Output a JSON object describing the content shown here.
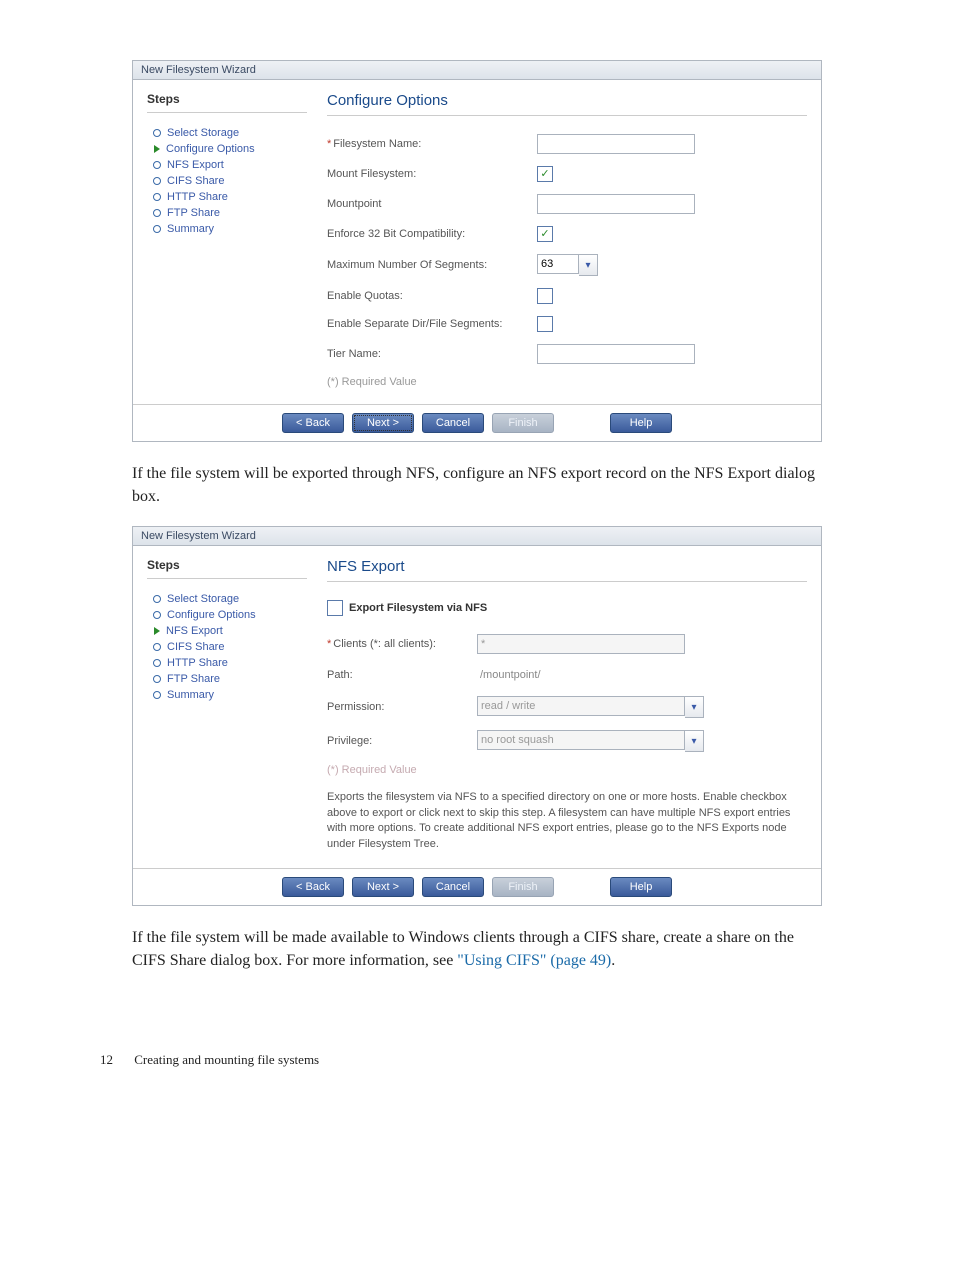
{
  "wizard1": {
    "window_title": "New Filesystem Wizard",
    "steps_heading": "Steps",
    "steps": [
      "Select Storage",
      "Configure Options",
      "NFS Export",
      "CIFS Share",
      "HTTP Share",
      "FTP Share",
      "Summary"
    ],
    "current_step_index": 1,
    "panel_title": "Configure Options",
    "fields": {
      "fs_name": {
        "label": "Filesystem Name:",
        "required": true,
        "value": ""
      },
      "mount_fs": {
        "label": "Mount Filesystem:",
        "checked": true
      },
      "mountpoint": {
        "label": "Mountpoint",
        "value": ""
      },
      "enforce32": {
        "label": "Enforce 32 Bit Compatibility:",
        "checked": true
      },
      "max_segments": {
        "label": "Maximum Number Of Segments:",
        "value": "63"
      },
      "quotas": {
        "label": "Enable Quotas:",
        "checked": false
      },
      "sep_segments": {
        "label": "Enable Separate Dir/File Segments:",
        "checked": false
      },
      "tier_name": {
        "label": "Tier Name:",
        "value": ""
      }
    },
    "required_note": "(*) Required Value",
    "buttons": {
      "back": "< Back",
      "next": "Next >",
      "cancel": "Cancel",
      "finish": "Finish",
      "help": "Help"
    }
  },
  "para1": "If the file system will be exported through NFS, configure an NFS export record on the NFS Export dialog box.",
  "wizard2": {
    "window_title": "New Filesystem Wizard",
    "steps_heading": "Steps",
    "steps": [
      "Select Storage",
      "Configure Options",
      "NFS Export",
      "CIFS Share",
      "HTTP Share",
      "FTP Share",
      "Summary"
    ],
    "current_step_index": 2,
    "panel_title": "NFS Export",
    "export_checkbox_label": "Export Filesystem via NFS",
    "export_checked": false,
    "fields": {
      "clients": {
        "label": "Clients (*: all clients):",
        "required": true,
        "value": "*"
      },
      "path": {
        "label": "Path:",
        "value": "/mountpoint/"
      },
      "permission": {
        "label": "Permission:",
        "value": "read / write"
      },
      "privilege": {
        "label": "Privilege:",
        "value": "no root squash"
      }
    },
    "required_note": "(*) Required Value",
    "help_text": "Exports the filesystem via NFS to a specified directory on one or more hosts. Enable checkbox above to export or click next to skip this step. A filesystem can have multiple NFS export entries with more options. To create additional NFS export entries, please go to the NFS Exports node under Filesystem Tree.",
    "buttons": {
      "back": "< Back",
      "next": "Next >",
      "cancel": "Cancel",
      "finish": "Finish",
      "help": "Help"
    }
  },
  "para2_pre": "If the file system will be made available to Windows clients through a CIFS share, create a share on the CIFS Share dialog box. For more information, see ",
  "para2_link": "\"Using CIFS\" (page 49)",
  "para2_post": ".",
  "footer": {
    "page_num": "12",
    "chapter": "Creating and mounting file systems"
  }
}
